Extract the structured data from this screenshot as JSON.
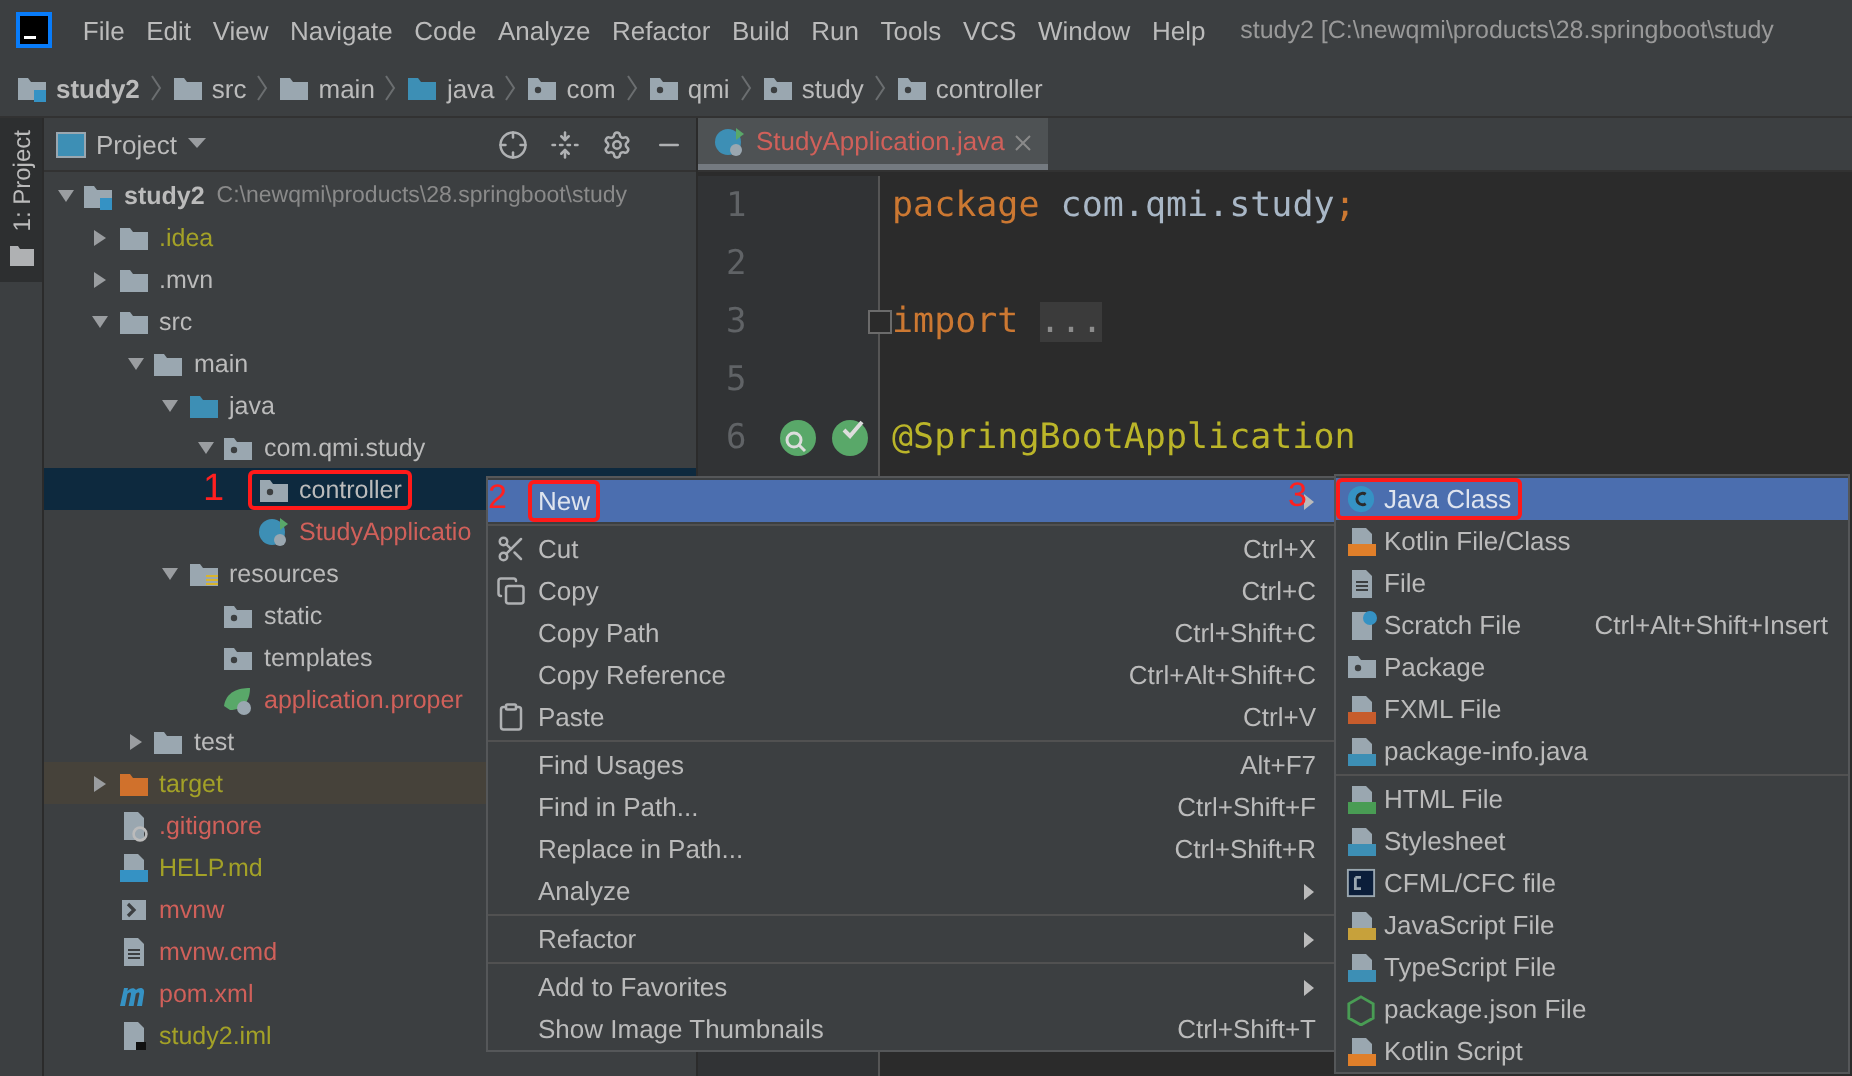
{
  "menu_bar": {
    "items": [
      "File",
      "Edit",
      "View",
      "Navigate",
      "Code",
      "Analyze",
      "Refactor",
      "Build",
      "Run",
      "Tools",
      "VCS",
      "Window",
      "Help"
    ],
    "title": "study2 [C:\\newqmi\\products\\28.springboot\\study"
  },
  "breadcrumbs": [
    {
      "label": "study2",
      "kind": "module"
    },
    {
      "label": "src",
      "kind": "folder"
    },
    {
      "label": "main",
      "kind": "folder"
    },
    {
      "label": "java",
      "kind": "source-folder"
    },
    {
      "label": "com",
      "kind": "package"
    },
    {
      "label": "qmi",
      "kind": "package"
    },
    {
      "label": "study",
      "kind": "package"
    },
    {
      "label": "controller",
      "kind": "package"
    }
  ],
  "tool_stripe": {
    "label": "1: Project"
  },
  "project_panel": {
    "title": "Project",
    "tree": [
      {
        "label": "study2",
        "path": "C:\\newqmi\\products\\28.springboot\\study",
        "kind": "module",
        "expanded": true,
        "selected": false,
        "children": [
          {
            "label": ".idea",
            "kind": "folder",
            "expanded": false,
            "selected": false,
            "color": "#a3a127"
          },
          {
            "label": ".mvn",
            "kind": "folder",
            "expanded": false,
            "selected": false
          },
          {
            "label": "src",
            "kind": "folder",
            "expanded": true,
            "selected": false,
            "children": [
              {
                "label": "main",
                "kind": "folder",
                "expanded": true,
                "selected": false,
                "children": [
                  {
                    "label": "java",
                    "kind": "source-folder",
                    "expanded": true,
                    "selected": false,
                    "children": [
                      {
                        "label": "com.qmi.study",
                        "kind": "package",
                        "expanded": true,
                        "selected": false,
                        "children": [
                          {
                            "label": "controller",
                            "kind": "package",
                            "selected": true,
                            "annotation": "1"
                          },
                          {
                            "label": "StudyApplicatio",
                            "kind": "spring-class",
                            "selected": false,
                            "color": "#d0605a"
                          }
                        ]
                      }
                    ]
                  },
                  {
                    "label": "resources",
                    "kind": "resources",
                    "expanded": true,
                    "selected": false,
                    "children": [
                      {
                        "label": "static",
                        "kind": "package",
                        "selected": false
                      },
                      {
                        "label": "templates",
                        "kind": "package",
                        "selected": false
                      },
                      {
                        "label": "application.proper",
                        "kind": "spring-config",
                        "selected": false,
                        "color": "#d0605a"
                      }
                    ]
                  }
                ]
              },
              {
                "label": "test",
                "kind": "folder",
                "expanded": false,
                "selected": false
              }
            ]
          },
          {
            "label": "target",
            "kind": "excluded-folder",
            "expanded": false,
            "selected": false,
            "color": "#a3a127"
          },
          {
            "label": ".gitignore",
            "kind": "ignore-file",
            "selected": false,
            "color": "#d0605a"
          },
          {
            "label": "HELP.md",
            "kind": "markdown",
            "selected": false,
            "color": "#a3a127"
          },
          {
            "label": "mvnw",
            "kind": "shell",
            "selected": false,
            "color": "#d0605a"
          },
          {
            "label": "mvnw.cmd",
            "kind": "text-file",
            "selected": false,
            "color": "#d0605a"
          },
          {
            "label": "pom.xml",
            "kind": "maven",
            "selected": false,
            "color": "#d0605a"
          },
          {
            "label": "study2.iml",
            "kind": "module-file",
            "selected": false,
            "color": "#a3a127"
          }
        ]
      }
    ]
  },
  "editor": {
    "tab": {
      "label": "StudyApplication.java",
      "selected": true,
      "color": "#d0605a"
    },
    "lines": [
      {
        "number": "1",
        "tokens": [
          {
            "text": "package",
            "kind": "keyword"
          },
          {
            "text": " com.qmi.study",
            "kind": "plain"
          },
          {
            "text": ";",
            "kind": "keyword"
          }
        ]
      },
      {
        "number": "2"
      },
      {
        "number": "3",
        "folded": true,
        "tokens": [
          {
            "text": "import",
            "kind": "keyword"
          },
          {
            "text": "...",
            "kind": "folded"
          }
        ]
      },
      {
        "number": "5"
      },
      {
        "number": "6",
        "kind": "spring-bean",
        "tokens": [
          {
            "text": "@SpringBootApplication",
            "kind": "annotation"
          }
        ]
      }
    ]
  },
  "context_menu": {
    "groups": [
      [
        {
          "label": "New",
          "selected": true,
          "has_submenu": true,
          "annotation": "2"
        }
      ],
      [
        {
          "label": "Cut",
          "kind": "cut",
          "shortcut": "Ctrl+X",
          "selected": false,
          "has_submenu": false
        },
        {
          "label": "Copy",
          "kind": "copy",
          "shortcut": "Ctrl+C",
          "selected": false,
          "has_submenu": false
        },
        {
          "label": "Copy Path",
          "shortcut": "Ctrl+Shift+C",
          "selected": false,
          "has_submenu": false
        },
        {
          "label": "Copy Reference",
          "shortcut": "Ctrl+Alt+Shift+C",
          "selected": false,
          "has_submenu": false
        },
        {
          "label": "Paste",
          "kind": "paste",
          "shortcut": "Ctrl+V",
          "selected": false,
          "has_submenu": false
        }
      ],
      [
        {
          "label": "Find Usages",
          "shortcut": "Alt+F7",
          "selected": false,
          "has_submenu": false
        },
        {
          "label": "Find in Path...",
          "shortcut": "Ctrl+Shift+F",
          "selected": false,
          "has_submenu": false
        },
        {
          "label": "Replace in Path...",
          "shortcut": "Ctrl+Shift+R",
          "selected": false,
          "has_submenu": false
        },
        {
          "label": "Analyze",
          "selected": false,
          "has_submenu": true
        }
      ],
      [
        {
          "label": "Refactor",
          "selected": false,
          "has_submenu": true
        }
      ],
      [
        {
          "label": "Add to Favorites",
          "selected": false,
          "has_submenu": true
        },
        {
          "label": "Show Image Thumbnails",
          "shortcut": "Ctrl+Shift+T",
          "selected": false,
          "has_submenu": false
        }
      ]
    ]
  },
  "submenu": {
    "groups": [
      [
        {
          "label": "Java Class",
          "kind": "java-class",
          "selected": true,
          "annotation": "3"
        },
        {
          "label": "Kotlin File/Class",
          "kind": "kotlin",
          "selected": false
        },
        {
          "label": "File",
          "kind": "file",
          "selected": false
        },
        {
          "label": "Scratch File",
          "kind": "scratch",
          "shortcut": "Ctrl+Alt+Shift+Insert",
          "selected": false
        },
        {
          "label": "Package",
          "kind": "package",
          "selected": false
        },
        {
          "label": "FXML File",
          "kind": "fxml",
          "selected": false
        },
        {
          "label": "package-info.java",
          "kind": "java-file",
          "selected": false
        }
      ],
      [
        {
          "label": "HTML File",
          "kind": "html",
          "selected": false
        },
        {
          "label": "Stylesheet",
          "kind": "css",
          "selected": false
        },
        {
          "label": "CFML/CFC file",
          "kind": "cfml",
          "selected": false
        },
        {
          "label": "JavaScript File",
          "kind": "javascript",
          "selected": false
        },
        {
          "label": "TypeScript File",
          "kind": "typescript",
          "selected": false
        },
        {
          "label": "package.json File",
          "kind": "nodejs",
          "selected": false
        },
        {
          "label": "Kotlin Script",
          "kind": "kotlin-script",
          "selected": false
        }
      ]
    ]
  }
}
